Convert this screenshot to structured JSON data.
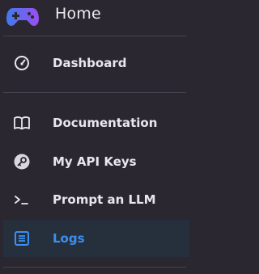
{
  "header": {
    "title": "Home",
    "logo_icon": "gamepad-logo-icon"
  },
  "nav": {
    "items": [
      {
        "label": "Dashboard",
        "icon": "gauge-icon"
      },
      {
        "label": "Documentation",
        "icon": "book-icon"
      },
      {
        "label": "My API Keys",
        "icon": "key-icon"
      },
      {
        "label": "Prompt an LLM",
        "icon": "terminal-prompt-icon"
      },
      {
        "label": "Logs",
        "icon": "logs-list-icon",
        "active": true
      }
    ]
  },
  "colors": {
    "background": "#2a2730",
    "text": "#e8e6ee",
    "active_text": "#3b8ff2",
    "active_background": "#26303d",
    "logo_gradient_start": "#3f7bf0",
    "logo_gradient_end": "#9b4ef0"
  }
}
